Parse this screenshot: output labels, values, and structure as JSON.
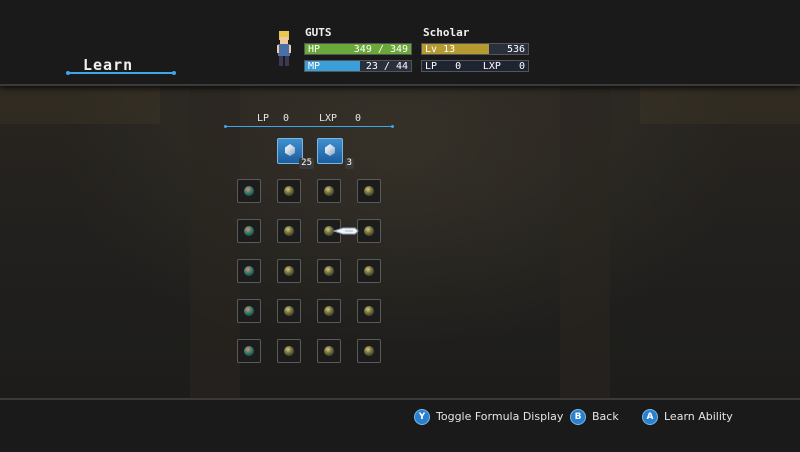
{
  "header": {
    "title": "Learn"
  },
  "character": {
    "name": "GUTS",
    "hp": {
      "label": "HP",
      "current": "349",
      "sep": "/",
      "max": "349",
      "fraction": 1.0
    },
    "mp": {
      "label": "MP",
      "current": "23",
      "sep": "/",
      "max": "44",
      "fraction": 0.52
    }
  },
  "job": {
    "name": "Scholar",
    "lv_label": "Lv",
    "lv": "13",
    "exp_to_next": "536",
    "lv_fraction": 0.63,
    "lp_label": "LP",
    "lp": "0",
    "lxp_label": "LXP",
    "lxp": "0"
  },
  "panel": {
    "lp_label": "LP",
    "lp": "0",
    "lxp_label": "LXP",
    "lxp": "0",
    "crystals": [
      {
        "name": "crystal-1",
        "count": "25"
      },
      {
        "name": "crystal-2",
        "count": "3"
      }
    ],
    "grid_rows": 5,
    "grid_cols": 4
  },
  "footer": {
    "y_button": {
      "key": "Y",
      "label": "Toggle Formula Display"
    },
    "b_button": {
      "key": "B",
      "label": "Back"
    },
    "a_button": {
      "key": "A",
      "label": "Learn Ability"
    }
  },
  "colors": {
    "accent": "#3ea5e8",
    "hp": "#6aa83a",
    "mp": "#3a9ed8",
    "lv": "#b59a32"
  }
}
